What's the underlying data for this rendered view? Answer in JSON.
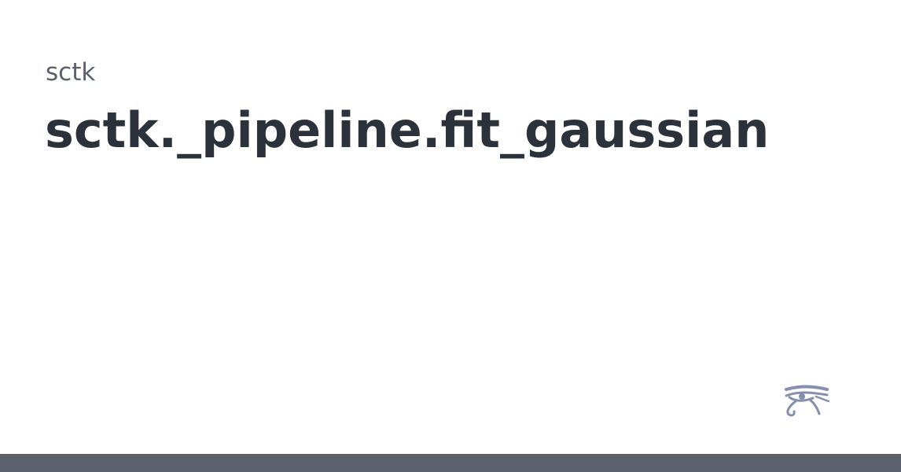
{
  "card": {
    "subtitle": "sctk",
    "title": "sctk._pipeline.fit_gaussian"
  },
  "logo": {
    "icon": "eye-of-horus-icon",
    "color": "#8690ae"
  },
  "bottom_bar": {
    "color": "#5a616d"
  }
}
